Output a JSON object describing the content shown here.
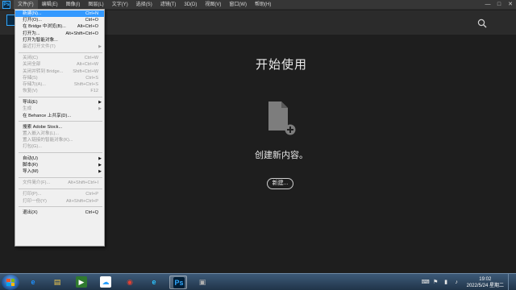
{
  "menubar": {
    "logo": "Ps",
    "items": [
      "文件(F)",
      "编辑(E)",
      "图像(I)",
      "图层(L)",
      "文字(Y)",
      "选择(S)",
      "滤镜(T)",
      "3D(D)",
      "视图(V)",
      "窗口(W)",
      "帮助(H)"
    ],
    "window_controls": [
      "—",
      "□",
      "✕"
    ]
  },
  "header": {
    "search_icon": "search-icon"
  },
  "main": {
    "title": "开始使用",
    "icon": "new-document-icon",
    "subtitle": "创建新内容。",
    "new_button": "新建..."
  },
  "file_menu": [
    {
      "label": "新建(N)...",
      "shortcut": "Ctrl+N",
      "state": "highlight"
    },
    {
      "label": "打开(O)...",
      "shortcut": "Ctrl+O"
    },
    {
      "label": "在 Bridge 中浏览(B)...",
      "shortcut": "Alt+Ctrl+O"
    },
    {
      "label": "打开为...",
      "shortcut": "Alt+Shift+Ctrl+O"
    },
    {
      "label": "打开为智能对象...",
      "shortcut": ""
    },
    {
      "label": "最近打开文件(T)",
      "shortcut": "",
      "submenu": true,
      "state": "disabled"
    },
    {
      "sep": true
    },
    {
      "label": "关闭(C)",
      "shortcut": "Ctrl+W",
      "state": "disabled"
    },
    {
      "label": "关闭全部",
      "shortcut": "Alt+Ctrl+W",
      "state": "disabled"
    },
    {
      "label": "关闭并转到 Bridge...",
      "shortcut": "Shift+Ctrl+W",
      "state": "disabled"
    },
    {
      "label": "存储(S)",
      "shortcut": "Ctrl+S",
      "state": "disabled"
    },
    {
      "label": "存储为(A)...",
      "shortcut": "Shift+Ctrl+S",
      "state": "disabled"
    },
    {
      "label": "恢复(V)",
      "shortcut": "F12",
      "state": "disabled"
    },
    {
      "sep": true
    },
    {
      "label": "导出(E)",
      "shortcut": "",
      "submenu": true
    },
    {
      "label": "生成",
      "shortcut": "",
      "submenu": true,
      "state": "disabled"
    },
    {
      "label": "在 Behance 上共享(D)...",
      "shortcut": ""
    },
    {
      "sep": true
    },
    {
      "label": "搜索 Adobe Stock...",
      "shortcut": ""
    },
    {
      "label": "置入嵌入对象(L)...",
      "shortcut": "",
      "state": "disabled"
    },
    {
      "label": "置入链接的智能对象(K)...",
      "shortcut": "",
      "state": "disabled"
    },
    {
      "label": "打包(G)...",
      "shortcut": "",
      "state": "disabled"
    },
    {
      "sep": true
    },
    {
      "label": "自动(U)",
      "shortcut": "",
      "submenu": true
    },
    {
      "label": "脚本(R)",
      "shortcut": "",
      "submenu": true
    },
    {
      "label": "导入(M)",
      "shortcut": "",
      "submenu": true
    },
    {
      "sep": true
    },
    {
      "label": "文件简介(F)...",
      "shortcut": "Alt+Shift+Ctrl+I",
      "state": "disabled"
    },
    {
      "sep": true
    },
    {
      "label": "打印(P)...",
      "shortcut": "Ctrl+P",
      "state": "disabled"
    },
    {
      "label": "打印一份(Y)",
      "shortcut": "Alt+Shift+Ctrl+P",
      "state": "disabled"
    },
    {
      "sep": true
    },
    {
      "label": "退出(X)",
      "shortcut": "Ctrl+Q"
    }
  ],
  "taskbar": {
    "apps": [
      {
        "name": "ie-icon",
        "glyph": "e",
        "color": "#1e90ff",
        "bg": "transparent"
      },
      {
        "name": "explorer-icon",
        "glyph": "▤",
        "color": "#f2c94c",
        "bg": "transparent"
      },
      {
        "name": "media-player-icon",
        "glyph": "▶",
        "color": "#ffffff",
        "bg": "#2f7a2f"
      },
      {
        "name": "baidu-netdisk-icon",
        "glyph": "☁",
        "color": "#2aa1ff",
        "bg": "#ffffff"
      },
      {
        "name": "chrome-icon",
        "glyph": "◉",
        "color": "#e34133",
        "bg": "transparent"
      },
      {
        "name": "edge-icon",
        "glyph": "e",
        "color": "#2bc3ff",
        "bg": "transparent"
      },
      {
        "name": "photoshop-icon",
        "glyph": "Ps",
        "color": "#31a8ff",
        "bg": "#001e36",
        "active": true
      },
      {
        "name": "generic-app-icon",
        "glyph": "▣",
        "color": "#b0b0b0",
        "bg": "transparent"
      }
    ],
    "tray_icons": [
      "input-method-icon",
      "flag-icon",
      "network-icon",
      "volume-icon"
    ],
    "time": "19:02",
    "date": "2022/5/24 星期二"
  },
  "colors": {
    "accent": "#31a8ff",
    "menu_highlight": "#3399ff",
    "background": "#1e1e1e"
  }
}
